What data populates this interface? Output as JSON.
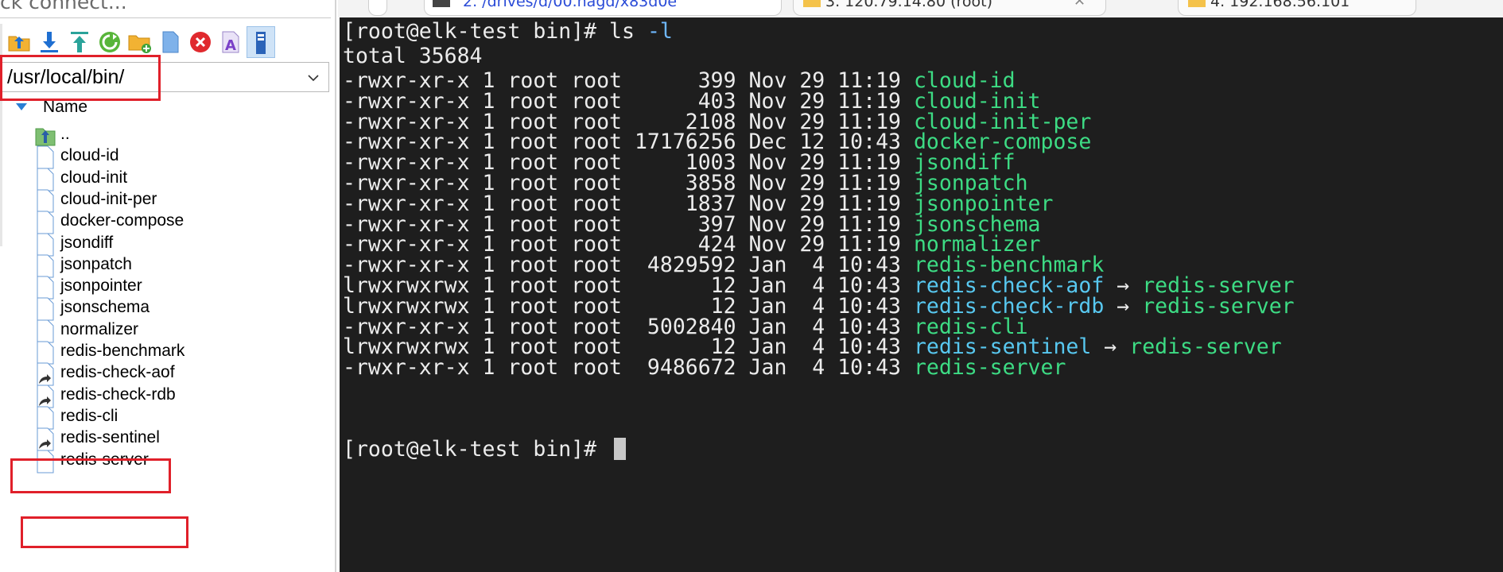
{
  "window": {
    "quick_connect": "ck connect...",
    "tabs": [
      {
        "label": "2. /drives/d/00.nagd/x83d0e"
      },
      {
        "label": "3. 120.79.14.80 (root)"
      },
      {
        "label": "4. 192.168.56.101"
      }
    ]
  },
  "file_panel": {
    "path": "/usr/local/bin/",
    "column_header": "Name",
    "parent_entry": "..",
    "files": [
      {
        "name": "cloud-id",
        "type": "file"
      },
      {
        "name": "cloud-init",
        "type": "file"
      },
      {
        "name": "cloud-init-per",
        "type": "file"
      },
      {
        "name": "docker-compose",
        "type": "file"
      },
      {
        "name": "jsondiff",
        "type": "file"
      },
      {
        "name": "jsonpatch",
        "type": "file"
      },
      {
        "name": "jsonpointer",
        "type": "file"
      },
      {
        "name": "jsonschema",
        "type": "file"
      },
      {
        "name": "normalizer",
        "type": "file"
      },
      {
        "name": "redis-benchmark",
        "type": "file"
      },
      {
        "name": "redis-check-aof",
        "type": "symlink"
      },
      {
        "name": "redis-check-rdb",
        "type": "symlink"
      },
      {
        "name": "redis-cli",
        "type": "file"
      },
      {
        "name": "redis-sentinel",
        "type": "symlink"
      },
      {
        "name": "redis-server",
        "type": "file"
      }
    ],
    "toolbar_icons": [
      "parent-dir-icon",
      "download-icon",
      "upload-icon",
      "refresh-icon",
      "new-folder-icon",
      "new-file-icon",
      "delete-icon",
      "rename-icon",
      "sync-icon"
    ]
  },
  "terminal": {
    "prompt": "[root@elk-test bin]# ",
    "command": "ls",
    "flag": "-l",
    "total_line": "total 35684",
    "arrow": "→",
    "entries": [
      {
        "meta": "-rwxr-xr-x 1 root root      399 Nov 29 11:19 ",
        "name": "cloud-id",
        "kind": "exe"
      },
      {
        "meta": "-rwxr-xr-x 1 root root      403 Nov 29 11:19 ",
        "name": "cloud-init",
        "kind": "exe"
      },
      {
        "meta": "-rwxr-xr-x 1 root root     2108 Nov 29 11:19 ",
        "name": "cloud-init-per",
        "kind": "exe"
      },
      {
        "meta": "-rwxr-xr-x 1 root root 17176256 Dec 12 10:43 ",
        "name": "docker-compose",
        "kind": "exe"
      },
      {
        "meta": "-rwxr-xr-x 1 root root     1003 Nov 29 11:19 ",
        "name": "jsondiff",
        "kind": "exe"
      },
      {
        "meta": "-rwxr-xr-x 1 root root     3858 Nov 29 11:19 ",
        "name": "jsonpatch",
        "kind": "exe"
      },
      {
        "meta": "-rwxr-xr-x 1 root root     1837 Nov 29 11:19 ",
        "name": "jsonpointer",
        "kind": "exe"
      },
      {
        "meta": "-rwxr-xr-x 1 root root      397 Nov 29 11:19 ",
        "name": "jsonschema",
        "kind": "exe"
      },
      {
        "meta": "-rwxr-xr-x 1 root root      424 Nov 29 11:19 ",
        "name": "normalizer",
        "kind": "exe"
      },
      {
        "meta": "-rwxr-xr-x 1 root root  4829592 Jan  4 10:43 ",
        "name": "redis-benchmark",
        "kind": "exe"
      },
      {
        "meta": "lrwxrwxrwx 1 root root       12 Jan  4 10:43 ",
        "name": "redis-check-aof",
        "kind": "link",
        "target": "redis-server"
      },
      {
        "meta": "lrwxrwxrwx 1 root root       12 Jan  4 10:43 ",
        "name": "redis-check-rdb",
        "kind": "link",
        "target": "redis-server"
      },
      {
        "meta": "-rwxr-xr-x 1 root root  5002840 Jan  4 10:43 ",
        "name": "redis-cli",
        "kind": "exe"
      },
      {
        "meta": "lrwxrwxrwx 1 root root       12 Jan  4 10:43 ",
        "name": "redis-sentinel",
        "kind": "link",
        "target": "redis-server"
      },
      {
        "meta": "-rwxr-xr-x 1 root root  9486672 Jan  4 10:43 ",
        "name": "redis-server",
        "kind": "exe"
      }
    ]
  },
  "colors": {
    "terminal_bg": "#1e1e1e",
    "executable": "#3ddc84",
    "symlink": "#58c8f0",
    "highlight": "#e0202a"
  }
}
